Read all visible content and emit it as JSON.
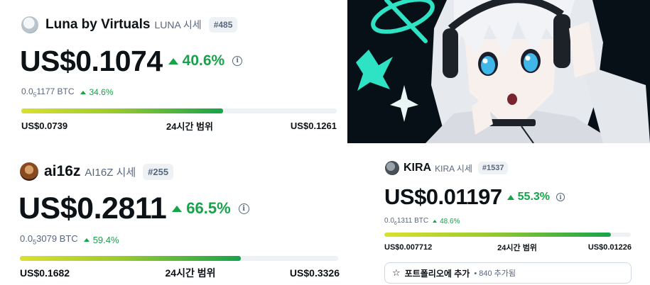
{
  "luna": {
    "name": "Luna by Virtuals",
    "symbol_label": "LUNA 시세",
    "rank": "#485",
    "price": "US$0.1074",
    "change": "40.6%",
    "btc_prefix": "0.0",
    "btc_sub": "5",
    "btc_rest": "1177 BTC",
    "btc_change": "34.6%",
    "range_low": "US$0.0739",
    "range_label": "24시간 범위",
    "range_high": "US$0.1261",
    "range_progress": 0.64
  },
  "ai16z": {
    "name": "ai16z",
    "symbol_label": "AI16Z 시세",
    "rank": "#255",
    "price": "US$0.2811",
    "change": "66.5%",
    "btc_prefix": "0.0",
    "btc_sub": "5",
    "btc_rest": "3079 BTC",
    "btc_change": "59.4%",
    "range_low": "US$0.1682",
    "range_label": "24시간 범위",
    "range_high": "US$0.3326",
    "range_progress": 0.695
  },
  "kira": {
    "name": "KIRA",
    "symbol_label": "KIRA 시세",
    "rank": "#1537",
    "price": "US$0.01197",
    "change": "55.3%",
    "btc_prefix": "0.0",
    "btc_sub": "6",
    "btc_rest": "1311 BTC",
    "btc_change": "48.6%",
    "range_low": "US$0.007712",
    "range_label": "24시간 범위",
    "range_high": "US$0.01226",
    "range_progress": 0.92,
    "portfolio_label": "포트폴리오에 추가",
    "portfolio_count": "840 추가됨"
  },
  "icons": {
    "up": "triangle-up-icon",
    "info": "info-circle-icon",
    "star": "star-outline-icon"
  },
  "colors": {
    "positive": "#16a34a",
    "muted": "#58667e",
    "rank_bg": "#eff2f5",
    "bar_track": "#eff2f5",
    "bar_start": "#dbe031",
    "bar_end": "#16a34a",
    "art_teal": "#2de3c4"
  }
}
